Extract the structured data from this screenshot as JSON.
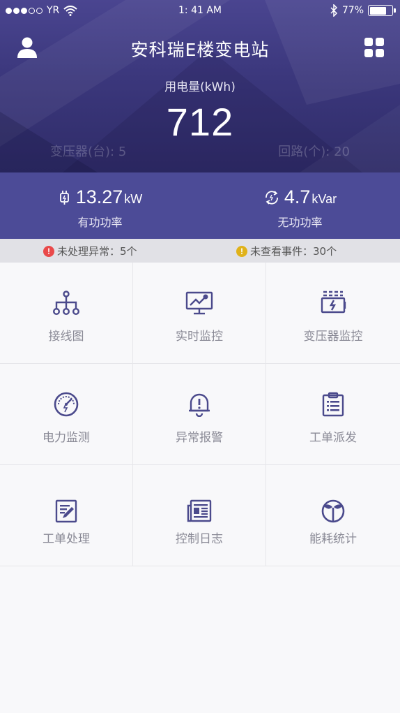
{
  "status_bar": {
    "carrier": "YR",
    "signal_filled": 3,
    "signal_total": 5,
    "time": "1: 41 AM",
    "battery_percent": "77%",
    "battery_level": 0.77
  },
  "header": {
    "title": "安科瑞E楼变电站",
    "user_icon": "user-icon",
    "menu_icon": "grid-icon",
    "energy_label": "用电量(kWh)",
    "energy_value": "712",
    "transformers_label": "变压器(台): 5",
    "circuits_label": "回路(个): 20"
  },
  "power": {
    "active": {
      "value": "13.27",
      "unit": "kW",
      "label": "有功功率",
      "icon": "plug-icon"
    },
    "reactive": {
      "value": "4.7",
      "unit": "kVar",
      "label": "无功功率",
      "icon": "cycle-icon"
    }
  },
  "alerts": {
    "unhandled": "未处理异常：5个",
    "unviewed": "未查看事件：30个"
  },
  "menu": [
    {
      "label": "接线图",
      "icon": "wiring-diagram-icon"
    },
    {
      "label": "实时监控",
      "icon": "monitor-icon"
    },
    {
      "label": "变压器监控",
      "icon": "transformer-icon"
    },
    {
      "label": "电力监测",
      "icon": "gauge-icon"
    },
    {
      "label": "异常报警",
      "icon": "alarm-bell-icon"
    },
    {
      "label": "工单派发",
      "icon": "clipboard-icon"
    },
    {
      "label": "工单处理",
      "icon": "edit-document-icon"
    },
    {
      "label": "控制日志",
      "icon": "log-icon"
    },
    {
      "label": "能耗统计",
      "icon": "leaf-icon"
    }
  ],
  "colors": {
    "header_top": "#4a4590",
    "header_bottom": "#2f2c68",
    "power_strip": "#4c4b97",
    "icon": "#4b4a8c",
    "alert_red": "#e9494a",
    "alert_yellow": "#e0b21a"
  }
}
